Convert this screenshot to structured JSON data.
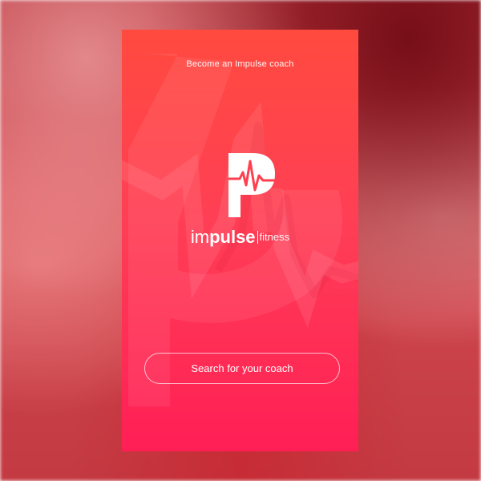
{
  "header": {
    "become_coach_link": "Become an Impulse coach"
  },
  "brand": {
    "logo_icon": "impulse-p-heartbeat-logo",
    "wordmark_im": "im",
    "wordmark_pulse": "pulse",
    "wordmark_fitness": "fitness"
  },
  "actions": {
    "search_button_label": "Search for your coach"
  },
  "colors": {
    "gradient_top": "#ff4a3f",
    "gradient_bottom": "#ff1f55",
    "text": "#ffffff"
  }
}
